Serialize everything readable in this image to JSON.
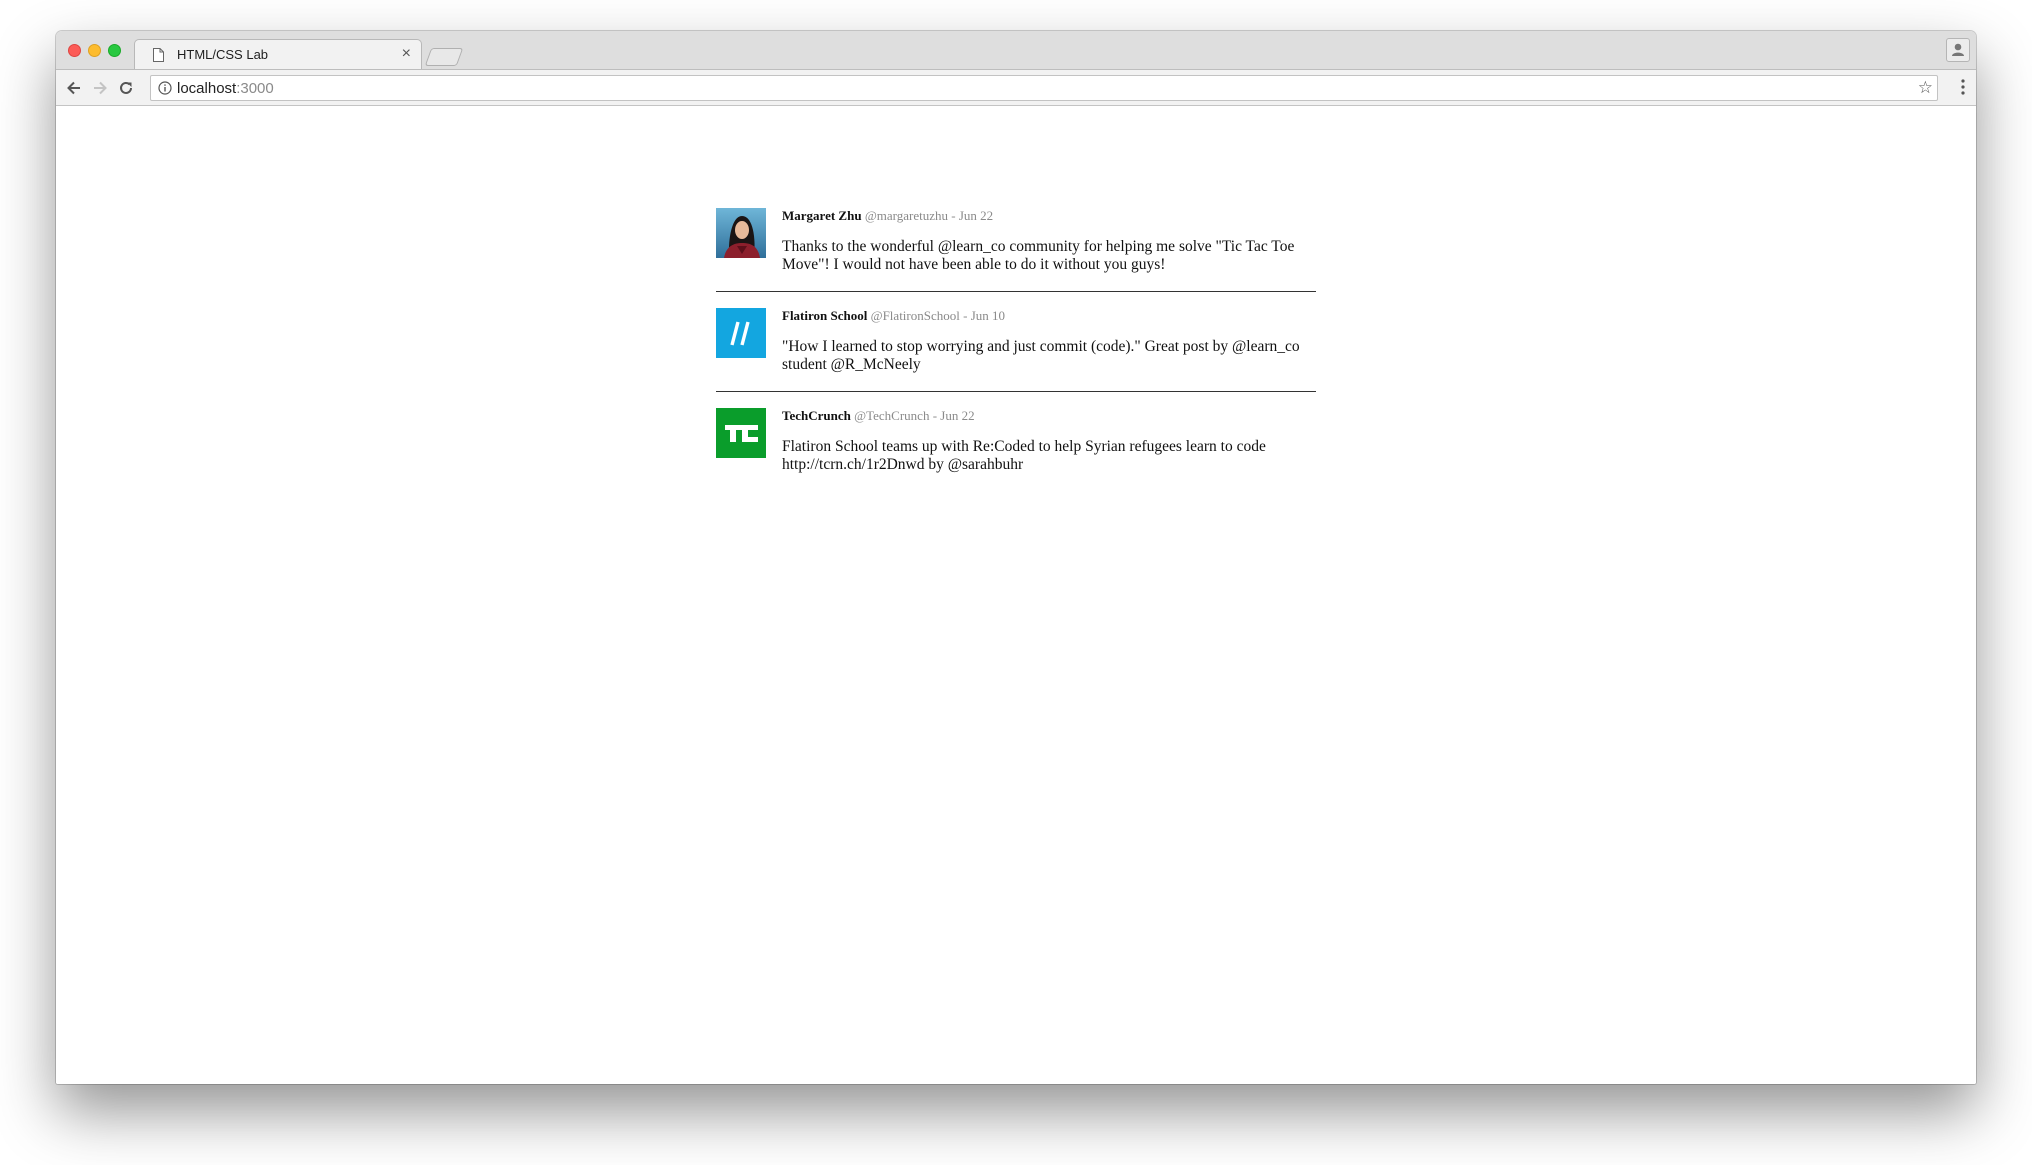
{
  "browser": {
    "tab_title": "HTML/CSS Lab",
    "tab_close": "×",
    "url_host": "localhost",
    "url_port": ":3000"
  },
  "tweets": [
    {
      "author": "Margaret Zhu",
      "handle": "@margaretuzhu",
      "separator": "-",
      "date": "Jun 22",
      "text": "Thanks to the wonderful @learn_co community for helping me solve \"Tic Tac Toe Move\"! I would not have been able to do it without you guys!",
      "avatar": "photo-avatar"
    },
    {
      "author": "Flatiron School",
      "handle": "@FlatironSchool",
      "separator": "-",
      "date": "Jun 10",
      "text": "\"How I learned to stop worrying and just commit (code).\" Great post by @learn_co student @R_McNeely",
      "avatar": "flatiron-logo",
      "avatar_color": "#13a6e0",
      "avatar_text": "//"
    },
    {
      "author": "TechCrunch",
      "handle": "@TechCrunch",
      "separator": "-",
      "date": "Jun 22",
      "text": "Flatiron School teams up with Re:Coded to help Syrian refugees learn to code http://tcrn.ch/1r2Dnwd by @sarahbuhr",
      "avatar": "techcrunch-logo",
      "avatar_color": "#0a9d2b",
      "avatar_text": "TC"
    }
  ]
}
